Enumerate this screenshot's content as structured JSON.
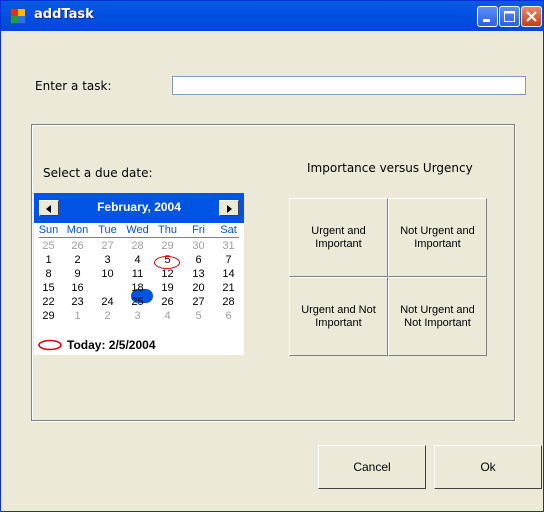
{
  "window": {
    "title": "addTask"
  },
  "task": {
    "label": "Enter a task:",
    "value": ""
  },
  "due_date": {
    "label": "Select a due date:"
  },
  "calendar": {
    "month_label": "February, 2004",
    "days_of_week": [
      "Sun",
      "Mon",
      "Tue",
      "Wed",
      "Thu",
      "Fri",
      "Sat"
    ],
    "weeks": [
      [
        "25",
        "26",
        "27",
        "28",
        "29",
        "30",
        "31"
      ],
      [
        "1",
        "2",
        "3",
        "4",
        "5",
        "6",
        "7"
      ],
      [
        "8",
        "9",
        "10",
        "11",
        "12",
        "13",
        "14"
      ],
      [
        "15",
        "16",
        "17",
        "18",
        "19",
        "20",
        "21"
      ],
      [
        "22",
        "23",
        "24",
        "25",
        "26",
        "27",
        "28"
      ],
      [
        "29",
        "1",
        "2",
        "3",
        "4",
        "5",
        "6"
      ]
    ],
    "selected_day": "17",
    "today_day": "5",
    "today_text": "Today: 2/5/2004"
  },
  "matrix": {
    "title": "Importance versus Urgency",
    "buttons": [
      "Urgent and\nImportant",
      "Not Urgent and\nImportant",
      "Urgent and Not\nImportant",
      "Not Urgent and\nNot Important"
    ]
  },
  "buttons": {
    "cancel": "Cancel",
    "ok": "Ok"
  },
  "colors": {
    "titlebar": "#0054e3",
    "calendar_header": "#0054e3",
    "today_ring": "#e00000"
  }
}
